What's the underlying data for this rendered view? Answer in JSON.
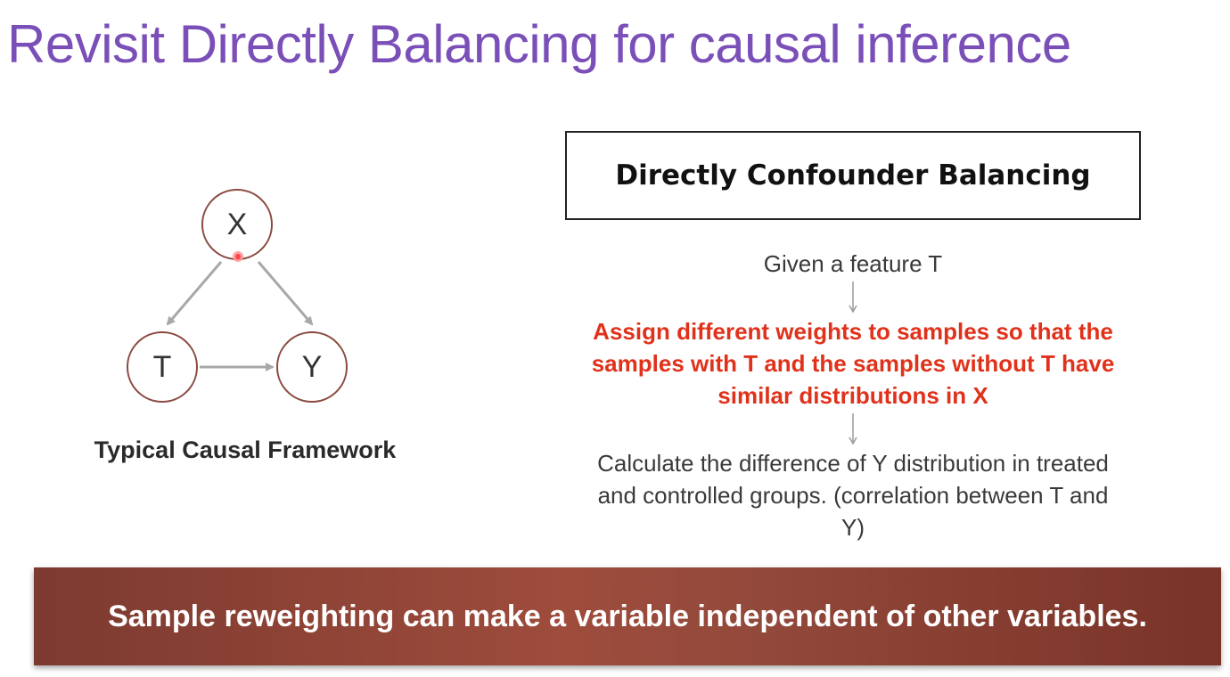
{
  "title": "Revisit Directly Balancing for causal inference",
  "diagram": {
    "nodes": {
      "x": "X",
      "t": "T",
      "y": "Y"
    },
    "caption": "Typical Causal Framework"
  },
  "method": {
    "header": "Directly Confounder Balancing",
    "step_given": "Given a feature T",
    "step_assign": "Assign different weights to samples so that the samples with T and the samples without T have similar distributions in X",
    "step_calculate": "Calculate the difference of Y distribution in treated and controlled groups. (correlation between T and Y)"
  },
  "banner": {
    "text": "Sample reweighting can make a variable independent of other variables."
  },
  "colors": {
    "title": "#7b4fb8",
    "highlight": "#e0321b",
    "node_border": "#8a4a40",
    "banner": "#9e4c3c"
  }
}
